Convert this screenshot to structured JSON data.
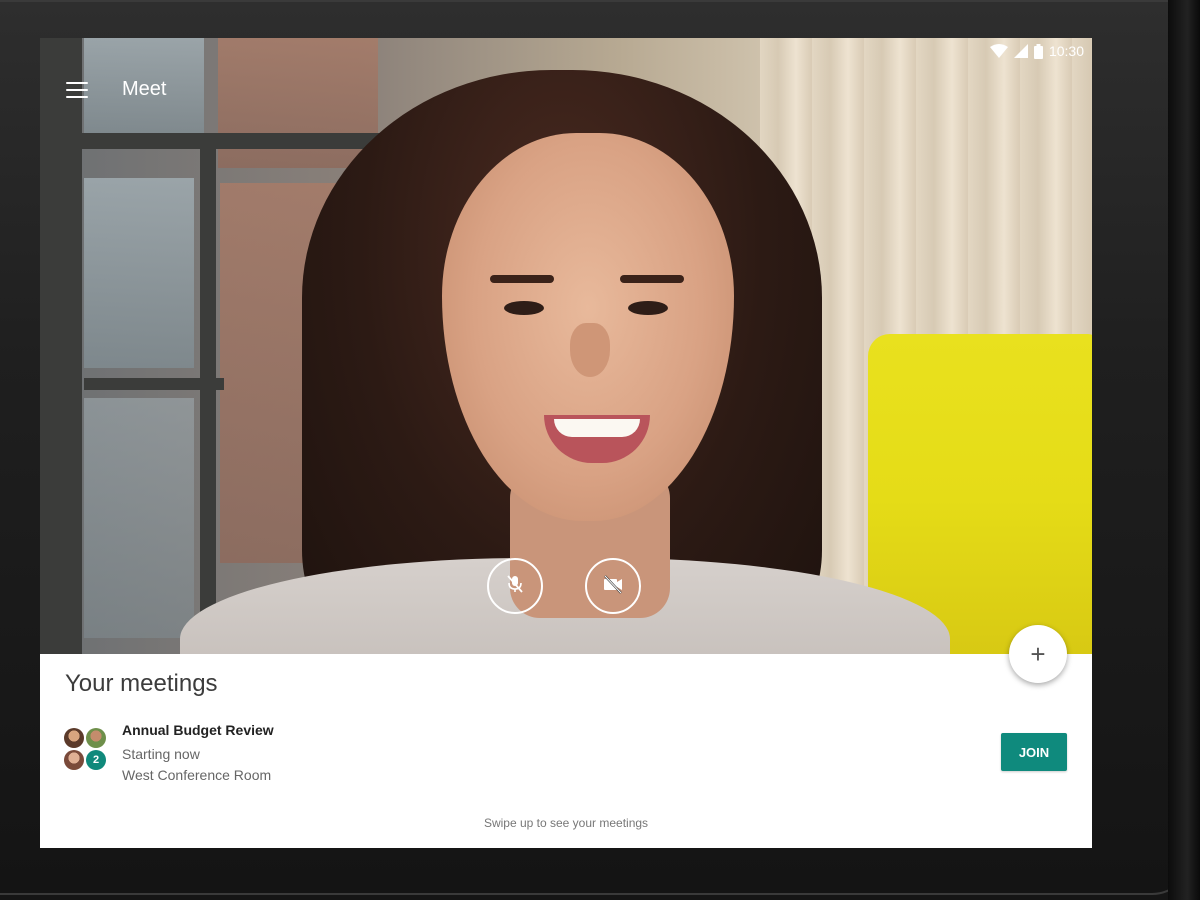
{
  "status_bar": {
    "time": "10:30"
  },
  "app_bar": {
    "title": "Meet"
  },
  "sheet": {
    "title": "Your meetings",
    "meeting": {
      "title": "Annual Budget Review",
      "status": "Starting now",
      "room": "West Conference Room",
      "extra_attendees": "2",
      "join_label": "JOIN"
    },
    "swipe_hint": "Swipe up to see your meetings",
    "fab_symbol": "+"
  },
  "colors": {
    "accent": "#0f8a7d"
  },
  "icons": {
    "menu": "hamburger-menu-icon",
    "mic": "mic-off-icon",
    "camera": "camera-off-icon",
    "wifi": "wifi-icon",
    "signal": "cell-signal-icon",
    "battery": "battery-icon",
    "add": "add-icon"
  }
}
